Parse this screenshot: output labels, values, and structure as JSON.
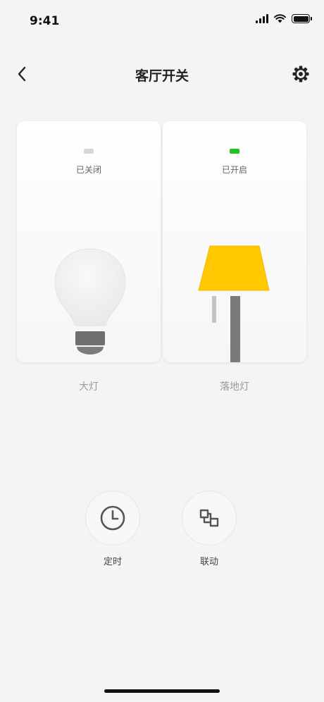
{
  "status_bar": {
    "time": "9:41"
  },
  "nav": {
    "title": "客厅开关"
  },
  "switches": [
    {
      "state_text": "已关闭",
      "name": "大灯",
      "on": false,
      "indicator_color": "#d6d6d6"
    },
    {
      "state_text": "已开启",
      "name": "落地灯",
      "on": true,
      "indicator_color": "#22c322"
    }
  ],
  "actions": {
    "timer_label": "定时",
    "link_label": "联动"
  },
  "colors": {
    "lamp_yellow": "#ffc800",
    "pole_gray": "#7a7a7a"
  }
}
